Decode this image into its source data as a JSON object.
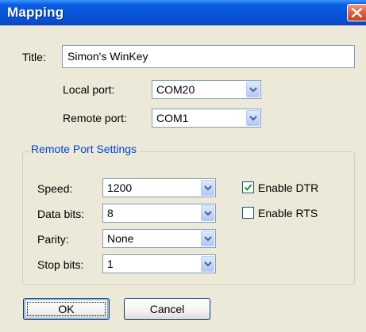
{
  "window": {
    "title": "Mapping",
    "close_icon": "close-icon"
  },
  "title_field": {
    "label": "Title:",
    "value": "Simon's WinKey"
  },
  "local_port": {
    "label": "Local port:",
    "selected": "COM20"
  },
  "remote_port": {
    "label": "Remote port:",
    "selected": "COM1"
  },
  "settings": {
    "group_title": "Remote Port Settings",
    "speed": {
      "label": "Speed:",
      "selected": "1200"
    },
    "data_bits": {
      "label": "Data bits:",
      "selected": "8"
    },
    "parity": {
      "label": "Parity:",
      "selected": "None"
    },
    "stop_bits": {
      "label": "Stop bits:",
      "selected": "1"
    },
    "enable_dtr": {
      "label": "Enable DTR",
      "checked": true
    },
    "enable_rts": {
      "label": "Enable RTS",
      "checked": false
    }
  },
  "buttons": {
    "ok": "OK",
    "cancel": "Cancel"
  },
  "colors": {
    "titlebar": "#0554d8",
    "group_title": "#0046d5",
    "dialog_bg": "#ece9d8",
    "close_button": "#e2623f",
    "check_mark": "#21a121"
  }
}
